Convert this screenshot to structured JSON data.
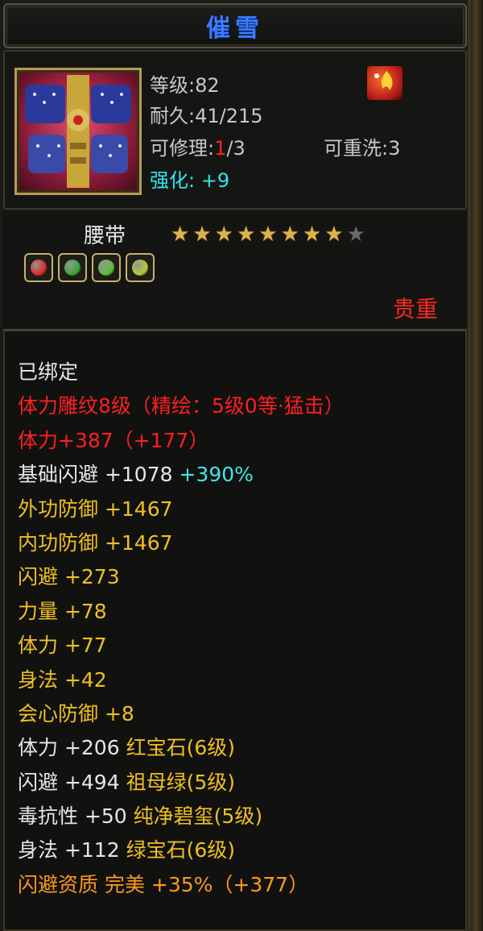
{
  "title": "催雪",
  "header": {
    "level_label": "等级",
    "level_value": "82",
    "durability_label": "耐久",
    "durability_value": "41/215",
    "repair_label": "可修理",
    "repair_current": "1",
    "repair_total": "/3",
    "rewash_label": "可重洗",
    "rewash_value": "3",
    "enhance_label": "强化",
    "enhance_value": "+9"
  },
  "item_type": "腰带",
  "stars": {
    "filled": 8,
    "total": 9
  },
  "gems": [
    {
      "name": "red-gem",
      "color": "#e02a2a"
    },
    {
      "name": "green-gem",
      "color": "#3aa83a"
    },
    {
      "name": "green-gem",
      "color": "#5cc03a"
    },
    {
      "name": "yellow-green-gem",
      "color": "#b8c83a"
    }
  ],
  "rarity": "贵重",
  "lines": [
    {
      "text": "已绑定",
      "color": "white"
    },
    {
      "text": "体力雕纹8级（精绘：5级0等·猛击）",
      "color": "red"
    },
    {
      "text": "体力+387（+177）",
      "color": "red"
    },
    {
      "text": "基础闪避 +1078 ",
      "color": "white",
      "extra": "+390%",
      "extra_color": "cyan"
    },
    {
      "text": "外功防御 +1467",
      "color": "yellow"
    },
    {
      "text": "内功防御 +1467",
      "color": "yellow"
    },
    {
      "text": "闪避 +273",
      "color": "yellow"
    },
    {
      "text": "力量 +78",
      "color": "yellow"
    },
    {
      "text": "体力 +77",
      "color": "yellow"
    },
    {
      "text": "身法 +42",
      "color": "yellow"
    },
    {
      "text": "会心防御 +8",
      "color": "yellow"
    },
    {
      "text": "体力 +206 ",
      "color": "white",
      "extra": "红宝石(6级)",
      "extra_color": "yellow"
    },
    {
      "text": "闪避 +494 ",
      "color": "white",
      "extra": "祖母绿(5级)",
      "extra_color": "yellow"
    },
    {
      "text": "毒抗性 +50 ",
      "color": "white",
      "extra": "纯净碧玺(5级)",
      "extra_color": "yellow"
    },
    {
      "text": "身法 +112 ",
      "color": "white",
      "extra": "绿宝石(6级)",
      "extra_color": "yellow"
    },
    {
      "text": "闪避资质  完美  +35%（+377）",
      "color": "orange"
    }
  ]
}
